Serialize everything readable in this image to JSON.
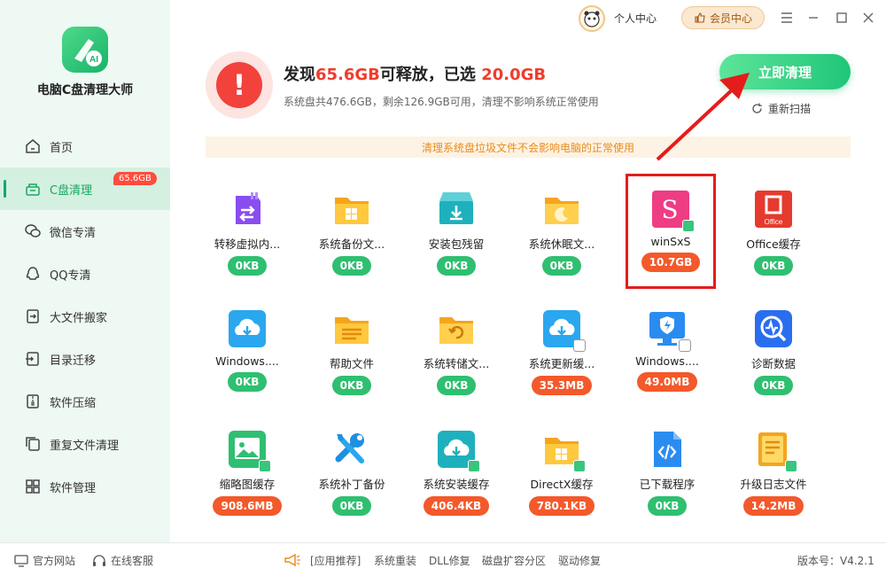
{
  "app": {
    "title": "电脑C盘清理大师"
  },
  "sidebar": {
    "items": [
      {
        "label": "首页",
        "icon": "home-icon"
      },
      {
        "label": "C盘清理",
        "icon": "broom-icon",
        "badge": "65.6GB",
        "active": true
      },
      {
        "label": "微信专清",
        "icon": "wechat-icon"
      },
      {
        "label": "QQ专清",
        "icon": "qq-icon"
      },
      {
        "label": "大文件搬家",
        "icon": "move-icon"
      },
      {
        "label": "目录迁移",
        "icon": "migrate-icon"
      },
      {
        "label": "软件压缩",
        "icon": "zip-icon"
      },
      {
        "label": "重复文件清理",
        "icon": "duplicate-icon"
      },
      {
        "label": "软件管理",
        "icon": "apps-icon"
      }
    ]
  },
  "topbar": {
    "profile": "个人中心",
    "member": "会员中心"
  },
  "header": {
    "found_prefix": "发现",
    "found_size": "65.6GB",
    "found_mid": "可释放，已选 ",
    "selected_size": "20.0GB",
    "disk_info": "系统盘共476.6GB，剩余126.9GB可用，清理不影响系统正常使用",
    "clean_button": "立即清理",
    "rescan": "重新扫描"
  },
  "notice": "清理系统盘垃圾文件不会影响电脑的正常使用",
  "items": [
    {
      "label": "转移虚拟内...",
      "size": "0KB",
      "icon": "virtual-memory-icon",
      "checked": false
    },
    {
      "label": "系统备份文...",
      "size": "0KB",
      "icon": "backup-folder-icon",
      "checked": false
    },
    {
      "label": "安装包残留",
      "size": "0KB",
      "icon": "installer-icon",
      "checked": false
    },
    {
      "label": "系统休眠文...",
      "size": "0KB",
      "icon": "hibernate-folder-icon",
      "checked": false
    },
    {
      "label": "winSxS",
      "size": "10.7GB",
      "icon": "winsxs-icon",
      "checked": true
    },
    {
      "label": "Office缓存",
      "size": "0KB",
      "icon": "office-icon",
      "checked": false
    },
    {
      "label": "Windows....",
      "size": "0KB",
      "icon": "cloud-download-icon",
      "checked": false
    },
    {
      "label": "帮助文件",
      "size": "0KB",
      "icon": "help-folder-icon",
      "checked": false
    },
    {
      "label": "系统转储文...",
      "size": "0KB",
      "icon": "dump-folder-icon",
      "checked": false
    },
    {
      "label": "系统更新缓...",
      "size": "35.3MB",
      "icon": "update-cache-icon",
      "checked": false,
      "box": true
    },
    {
      "label": "Windows....",
      "size": "49.0MB",
      "icon": "defender-icon",
      "checked": false,
      "box": true
    },
    {
      "label": "诊断数据",
      "size": "0KB",
      "icon": "diagnostic-icon",
      "checked": false
    },
    {
      "label": "缩略图缓存",
      "size": "908.6MB",
      "icon": "thumbnail-icon",
      "checked": true
    },
    {
      "label": "系统补丁备份",
      "size": "0KB",
      "icon": "wrench-icon",
      "checked": false
    },
    {
      "label": "系统安装缓存",
      "size": "406.4KB",
      "icon": "install-cache-icon",
      "checked": true
    },
    {
      "label": "DirectX缓存",
      "size": "780.1KB",
      "icon": "directx-folder-icon",
      "checked": true
    },
    {
      "label": "已下载程序",
      "size": "0KB",
      "icon": "code-file-icon",
      "checked": false
    },
    {
      "label": "升级日志文件",
      "size": "14.2MB",
      "icon": "log-file-icon",
      "checked": true
    }
  ],
  "footer": {
    "website": "官方网站",
    "support": "在线客服",
    "recommend": "[应用推荐]",
    "links": [
      "系统重装",
      "DLL修复",
      "磁盘扩容分区",
      "驱动修复"
    ],
    "version": "版本号：V4.2.1"
  }
}
